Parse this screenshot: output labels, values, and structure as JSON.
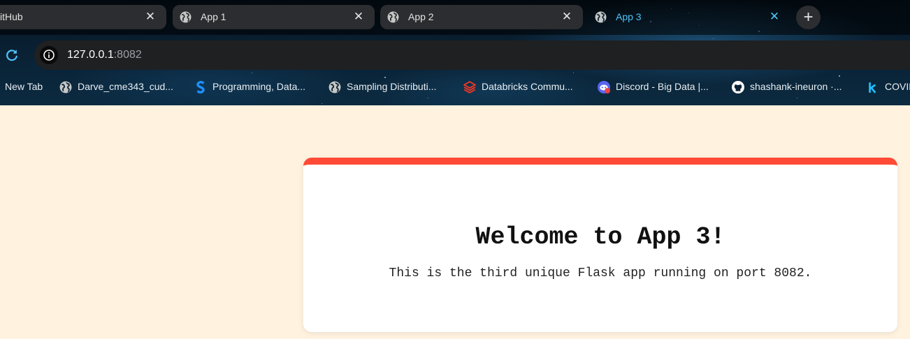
{
  "browser": {
    "tabs": [
      {
        "title": "itHub",
        "active": false
      },
      {
        "title": "App 1",
        "active": false
      },
      {
        "title": "App 2",
        "active": false
      },
      {
        "title": "App 3",
        "active": true
      }
    ],
    "close_glyph": "✕",
    "new_tab_glyph": "+",
    "address": {
      "host": "127.0.0.1",
      "port": ":8082"
    },
    "bookmarks": [
      {
        "label": "New Tab",
        "icon": "none"
      },
      {
        "label": "Darve_cme343_cud...",
        "icon": "globe-icon"
      },
      {
        "label": "Programming, Data...",
        "icon": "s-logo-icon"
      },
      {
        "label": "Sampling Distributi...",
        "icon": "globe-icon"
      },
      {
        "label": "Databricks Commu...",
        "icon": "databricks-icon"
      },
      {
        "label": "Discord - Big Data |...",
        "icon": "discord-icon"
      },
      {
        "label": "shashank-ineuron ·...",
        "icon": "github-icon"
      },
      {
        "label": "COVID",
        "icon": "k-logo-icon"
      }
    ],
    "accent_color": "#4fc3f7"
  },
  "page": {
    "heading": "Welcome to App 3!",
    "description": "This is the third unique Flask app running on port 8082.",
    "background_color": "#fff2df",
    "card_accent_color": "#ff4a35"
  }
}
